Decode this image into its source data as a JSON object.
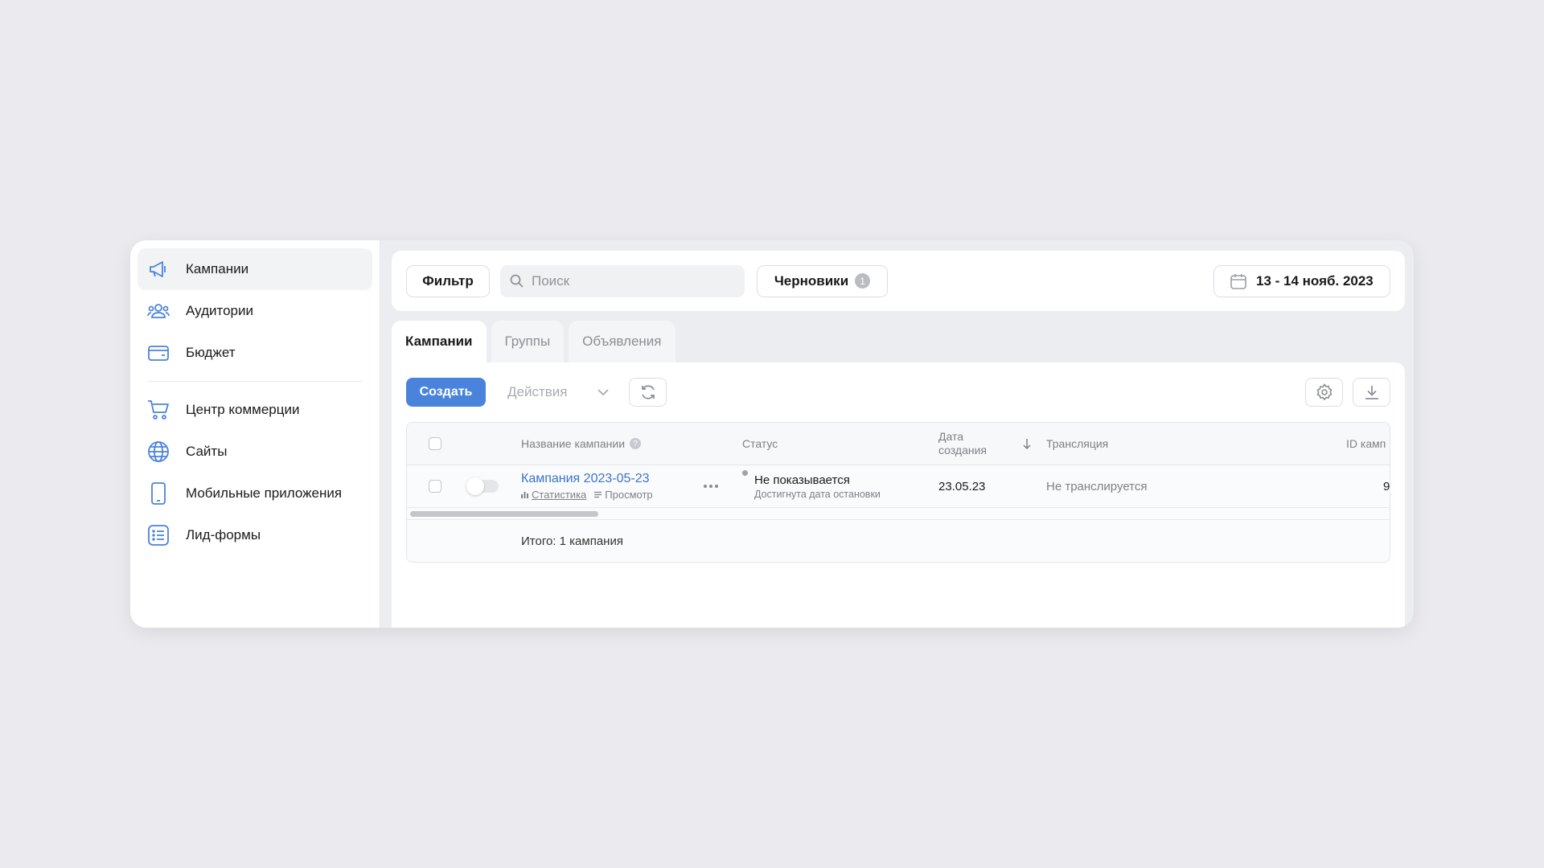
{
  "sidebar": {
    "items": [
      {
        "label": "Кампании",
        "icon": "megaphone-icon",
        "active": true
      },
      {
        "label": "Аудитории",
        "icon": "users-icon"
      },
      {
        "label": "Бюджет",
        "icon": "wallet-icon"
      },
      {
        "label": "Центр коммерции",
        "icon": "cart-icon"
      },
      {
        "label": "Сайты",
        "icon": "globe-icon"
      },
      {
        "label": "Мобильные приложения",
        "icon": "phone-icon"
      },
      {
        "label": "Лид-формы",
        "icon": "list-form-icon"
      }
    ]
  },
  "toolbar": {
    "filter_label": "Фильтр",
    "search_placeholder": "Поиск",
    "search_value": "",
    "drafts_label": "Черновики",
    "drafts_count": "1",
    "date_range": "13 - 14 нояб. 2023"
  },
  "tabs": [
    {
      "label": "Кампании",
      "active": true
    },
    {
      "label": "Группы"
    },
    {
      "label": "Объявления"
    }
  ],
  "actions": {
    "create_label": "Создать",
    "actions_label": "Действия"
  },
  "table": {
    "headers": {
      "name": "Название кампании",
      "status": "Статус",
      "date_line1": "Дата",
      "date_line2": "создания",
      "broadcast": "Трансляция",
      "id": "ID камп"
    },
    "rows": [
      {
        "name": "Кампания 2023-05-23",
        "stats_link": "Статистика",
        "preview_link": "Просмотр",
        "status": "Не показывается",
        "status_detail": "Достигнута дата остановки",
        "created": "23.05.23",
        "broadcast": "Не транслируется",
        "id_partial": "9"
      }
    ],
    "total": "Итого: 1 кампания"
  },
  "colors": {
    "accent": "#4a83db",
    "link": "#3a74c9",
    "icon": "#4a83db"
  }
}
